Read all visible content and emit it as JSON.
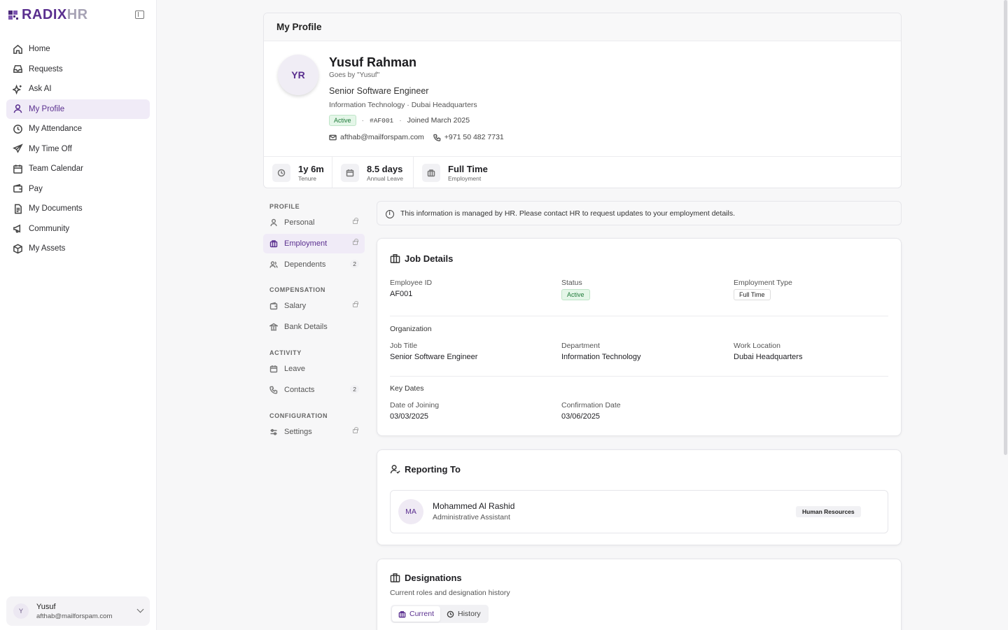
{
  "brand": {
    "name_main": "RADIX",
    "name_accent": "HR",
    "accent": "#5a2f8f"
  },
  "sidebar": {
    "items": [
      {
        "label": "Home",
        "icon": "home-icon"
      },
      {
        "label": "Requests",
        "icon": "inbox-icon"
      },
      {
        "label": "Ask AI",
        "icon": "sparkles-icon"
      },
      {
        "label": "My Profile",
        "icon": "user-icon",
        "active": true
      },
      {
        "label": "My Attendance",
        "icon": "clock-icon"
      },
      {
        "label": "My Time Off",
        "icon": "plane-icon"
      },
      {
        "label": "Team Calendar",
        "icon": "calendar-icon"
      },
      {
        "label": "Pay",
        "icon": "wallet-icon"
      },
      {
        "label": "My Documents",
        "icon": "document-icon"
      },
      {
        "label": "Community",
        "icon": "megaphone-icon"
      },
      {
        "label": "My Assets",
        "icon": "box-icon"
      }
    ],
    "user": {
      "initial": "Y",
      "name": "Yusuf",
      "email": "afthab@mailforspam.com"
    }
  },
  "profile": {
    "header_title": "My Profile",
    "initials": "YR",
    "name": "Yusuf Rahman",
    "alias": "Goes by \"Yusuf\"",
    "job_title": "Senior Software Engineer",
    "dept_line": "Information Technology · Dubai Headquarters",
    "status": "Active",
    "employee_code": "#AF001",
    "joined": "Joined March 2025",
    "email": "afthab@mailforspam.com",
    "phone": "+971 50 482 7731",
    "stats": [
      {
        "value": "1y 6m",
        "label": "Tenure",
        "icon": "clock-icon"
      },
      {
        "value": "8.5 days",
        "label": "Annual Leave",
        "icon": "calendar-icon"
      },
      {
        "value": "Full Time",
        "label": "Employment",
        "icon": "briefcase-icon"
      }
    ]
  },
  "subnav": {
    "sections": [
      {
        "heading": "PROFILE",
        "items": [
          {
            "label": "Personal",
            "icon": "user-icon",
            "suffix": "lock"
          },
          {
            "label": "Employment",
            "icon": "briefcase-icon",
            "suffix": "lock",
            "active": true
          },
          {
            "label": "Dependents",
            "icon": "users-icon",
            "count": "2"
          }
        ]
      },
      {
        "heading": "COMPENSATION",
        "items": [
          {
            "label": "Salary",
            "icon": "wallet-icon",
            "suffix": "lock"
          },
          {
            "label": "Bank Details",
            "icon": "bank-icon"
          }
        ]
      },
      {
        "heading": "ACTIVITY",
        "items": [
          {
            "label": "Leave",
            "icon": "calendar-icon"
          },
          {
            "label": "Contacts",
            "icon": "phone-icon",
            "count": "2"
          }
        ]
      },
      {
        "heading": "CONFIGURATION",
        "items": [
          {
            "label": "Settings",
            "icon": "sliders-icon",
            "suffix": "lock"
          }
        ]
      }
    ]
  },
  "notice": "This information is managed by HR. Please contact HR to request updates to your employment details.",
  "job_details": {
    "title": "Job Details",
    "employee_id_label": "Employee ID",
    "employee_id": "AF001",
    "status_label": "Status",
    "status": "Active",
    "type_label": "Employment Type",
    "type": "Full Time",
    "org_heading": "Organization",
    "job_title_label": "Job Title",
    "job_title": "Senior Software Engineer",
    "department_label": "Department",
    "department": "Information Technology",
    "location_label": "Work Location",
    "location": "Dubai Headquarters",
    "dates_heading": "Key Dates",
    "doj_label": "Date of Joining",
    "doj": "03/03/2025",
    "confirm_label": "Confirmation Date",
    "confirm": "03/06/2025"
  },
  "reporting": {
    "title": "Reporting To",
    "initials": "MA",
    "name": "Mohammed Al Rashid",
    "role": "Administrative Assistant",
    "dept": "Human Resources"
  },
  "designations": {
    "title": "Designations",
    "subtitle": "Current roles and designation history",
    "tab_current": "Current",
    "tab_history": "History"
  }
}
